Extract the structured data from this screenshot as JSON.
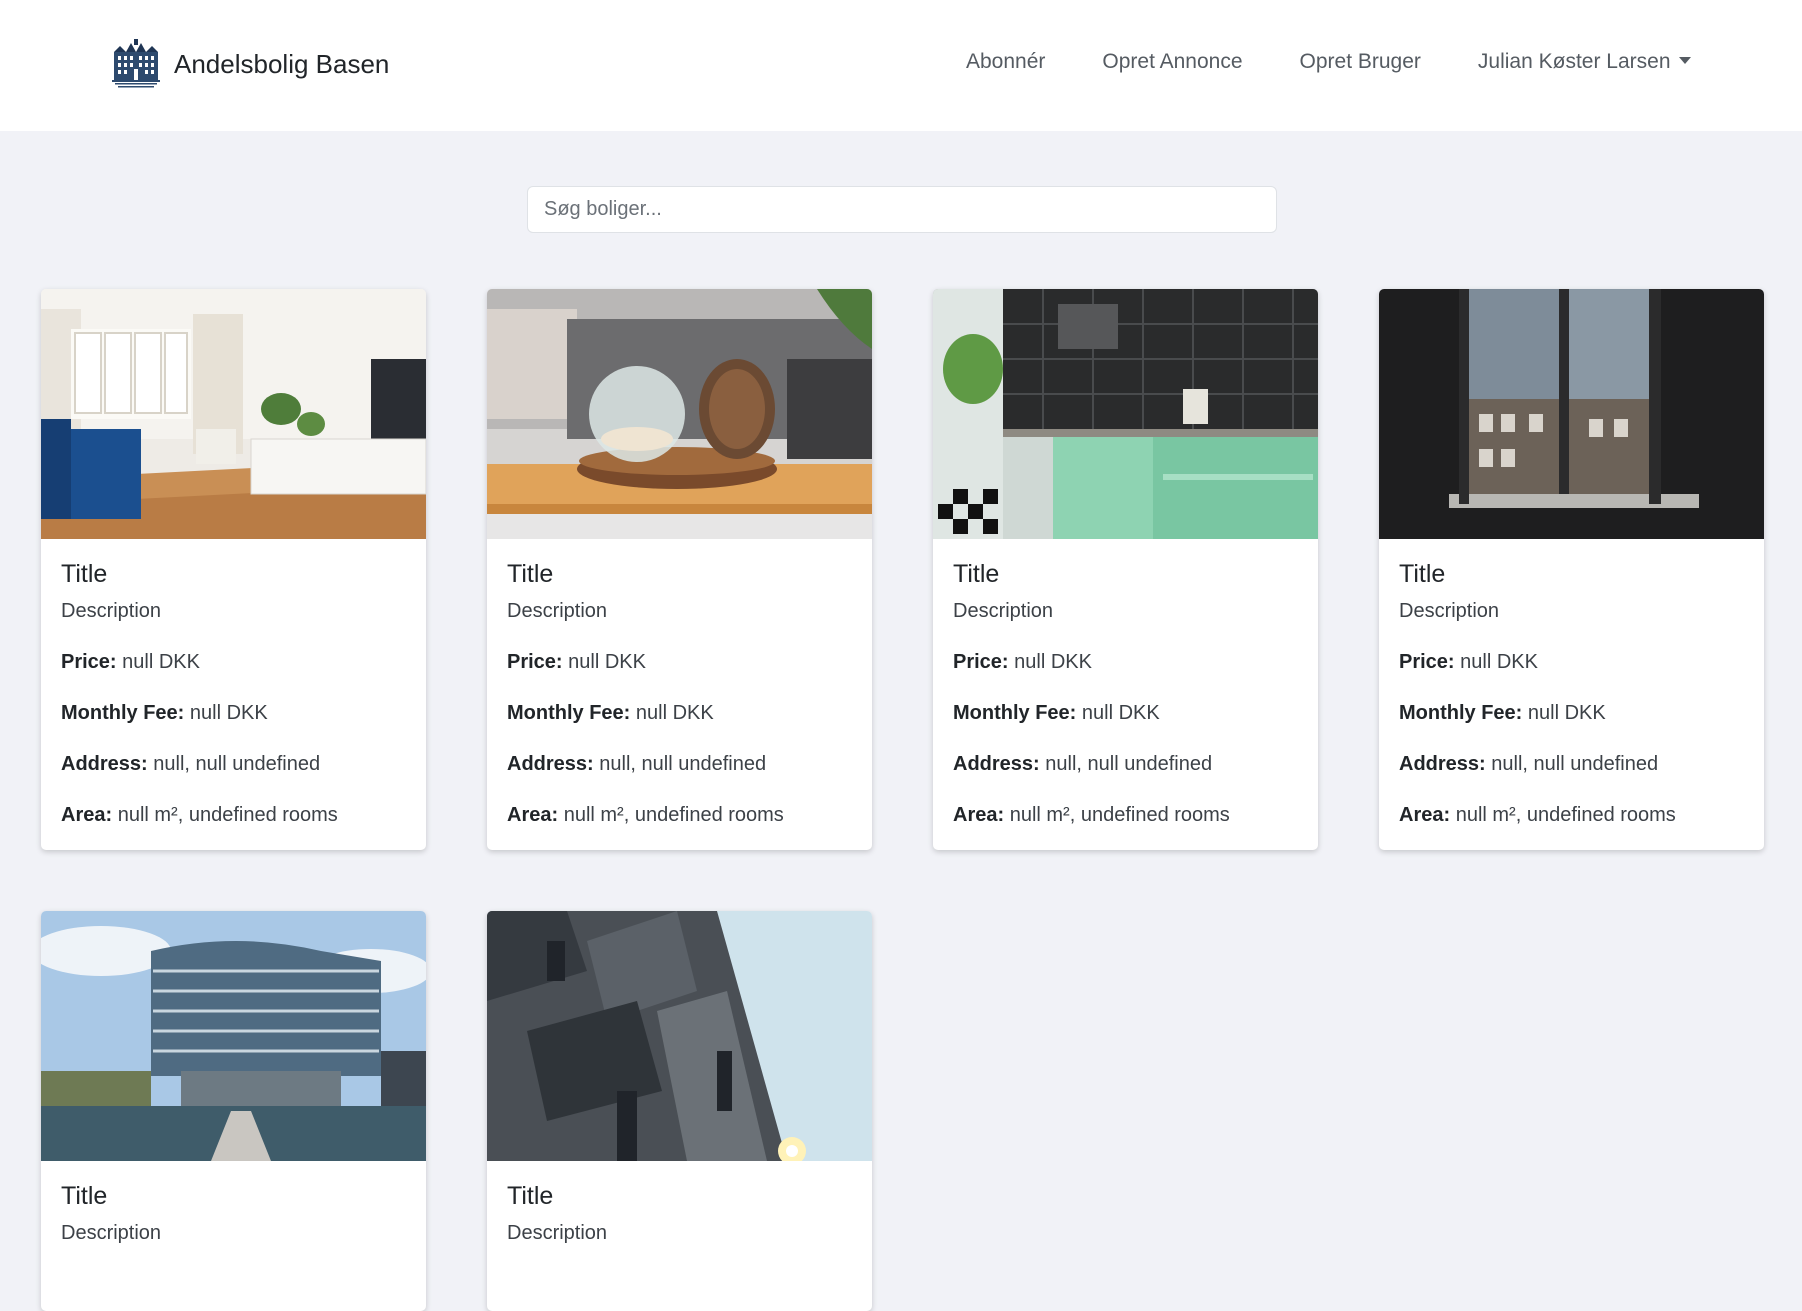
{
  "brand": {
    "name": "Andelsbolig Basen"
  },
  "nav": {
    "subscribe": "Abonnér",
    "create_listing": "Opret Annonce",
    "create_user": "Opret Bruger",
    "user": "Julian Køster Larsen"
  },
  "search": {
    "placeholder": "Søg boliger..."
  },
  "labels": {
    "price": "Price:",
    "monthly_fee": "Monthly Fee:",
    "address": "Address:",
    "area": "Area:"
  },
  "listings": [
    {
      "title": "Title",
      "description": "Description",
      "price": "null DKK",
      "monthly_fee": "null DKK",
      "address": "null, null undefined",
      "area": "null m², undefined rooms",
      "image": "living-room"
    },
    {
      "title": "Title",
      "description": "Description",
      "price": "null DKK",
      "monthly_fee": "null DKK",
      "address": "null, null undefined",
      "area": "null m², undefined rooms",
      "image": "coffee-table"
    },
    {
      "title": "Title",
      "description": "Description",
      "price": "null DKK",
      "monthly_fee": "null DKK",
      "address": "null, null undefined",
      "area": "null m², undefined rooms",
      "image": "kitchen"
    },
    {
      "title": "Title",
      "description": "Description",
      "price": "null DKK",
      "monthly_fee": "null DKK",
      "address": "null, null undefined",
      "area": "null m², undefined rooms",
      "image": "window"
    },
    {
      "title": "Title",
      "description": "Description",
      "image": "waterfront-building"
    },
    {
      "title": "Title",
      "description": "Description",
      "image": "modern-facade"
    }
  ],
  "colors": {
    "page_bg": "#f1f2f7",
    "navbar_bg": "#ffffff",
    "card_bg": "#ffffff",
    "text": "#212529",
    "nav_text": "#555b62"
  }
}
